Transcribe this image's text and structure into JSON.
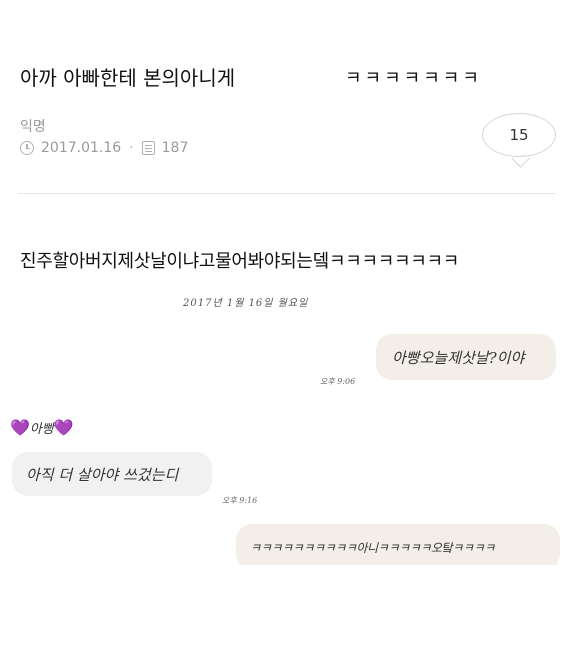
{
  "post": {
    "title": "아까 아빠한테 본의아니게",
    "title_laugh": "ㅋㅋㅋㅋㅋㅋㅋ",
    "author": "익명",
    "date": "2017.01.16",
    "separator": "·",
    "views": "187",
    "comment_count": "15"
  },
  "body": {
    "text": "진주할아버지제삿날이냐고물어봐야되는뎈ㅋㅋㅋㅋㅋㅋㅋㅋ"
  },
  "chat": {
    "date": "2017년 1월 16일 월요일",
    "sender_name": "아빵",
    "sender_heart_left": "💜",
    "sender_heart_right": "💜",
    "messages": [
      {
        "from": "me",
        "text": "아빵오늘제삿날?이야",
        "time": "오후 9:06"
      },
      {
        "from": "them",
        "text": "아직 더 살아야 쓰겄는디",
        "time": "오후 9:16"
      },
      {
        "from": "me",
        "text": "ㅋㅋㅋㅋㅋㅋㅋㅋㅋㅋ아니ㅋㅋㅋㅋㅋ오탘ㅋㅋㅋㅋ",
        "time": ""
      }
    ]
  },
  "colors": {
    "my_bubble": "#f3efe8",
    "their_bubble": "#f1f1f1",
    "meta_gray": "#9a9a9a",
    "heart": "#8a2be2"
  }
}
